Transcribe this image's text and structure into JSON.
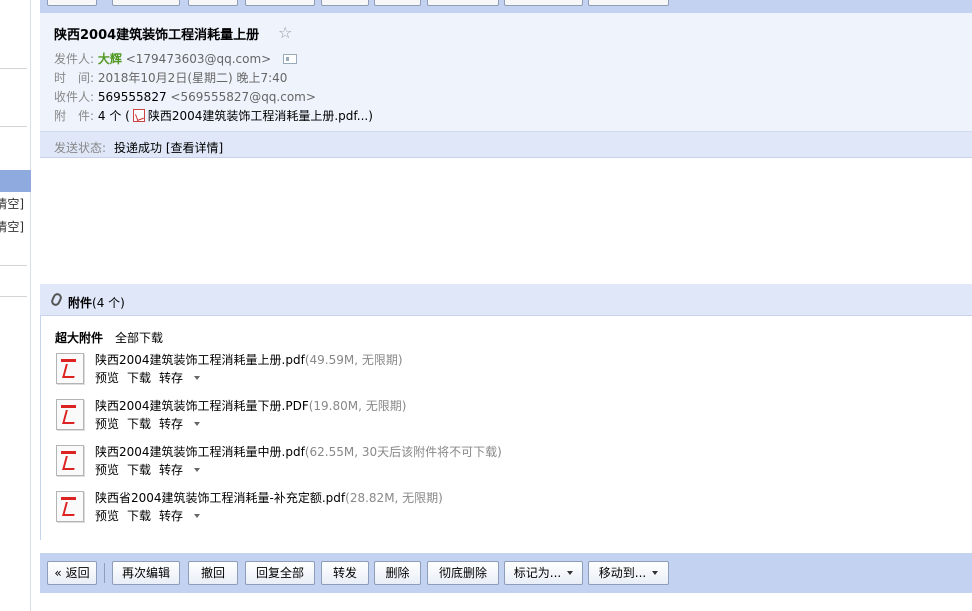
{
  "left": {
    "clear_label_1": "清空]",
    "clear_label_2": "清空]"
  },
  "email": {
    "subject": "陕西2004建筑装饰工程消耗量上册",
    "star_icon": "star-outline-icon",
    "from_label": "发件人:",
    "from_name": "大辉",
    "from_addr": "<179473603@qq.com>",
    "time_label": "时　间:",
    "time_value": "2018年10月2日(星期二) 晚上7:40",
    "to_label": "收件人:",
    "to_name": "569555827",
    "to_addr": "<569555827@qq.com>",
    "att_label": "附　件:",
    "att_summary_pre": "4 个 (",
    "att_summary_name": "陕西2004建筑装饰工程消耗量上册.pdf...)",
    "status_label": "发送状态:",
    "status_value": "投递成功 [查看详情]"
  },
  "attachments": {
    "title": "附件",
    "count": "(4 个)",
    "big_label": "超大附件",
    "download_all": "全部下载",
    "items": [
      {
        "name": "陕西2004建筑装饰工程消耗量上册.pdf",
        "meta": "(49.59M, 无限期)"
      },
      {
        "name": "陕西2004建筑装饰工程消耗量下册.PDF",
        "meta": "(19.80M, 无限期)"
      },
      {
        "name": "陕西2004建筑装饰工程消耗量中册.pdf",
        "meta": "(62.55M, 30天后该附件将不可下载)"
      },
      {
        "name": "陕西省2004建筑装饰工程消耗量-补充定额.pdf",
        "meta": "(28.82M, 无限期)"
      }
    ],
    "actions": {
      "preview": "预览",
      "download": "下载",
      "save": "转存"
    }
  },
  "toolbar": {
    "back": "« 返回",
    "reedit": "再次编辑",
    "recall": "撤回",
    "reply_all": "回复全部",
    "forward": "转发",
    "delete": "删除",
    "delete_perm": "彻底删除",
    "mark_as": "标记为...",
    "move_to": "移动到..."
  }
}
